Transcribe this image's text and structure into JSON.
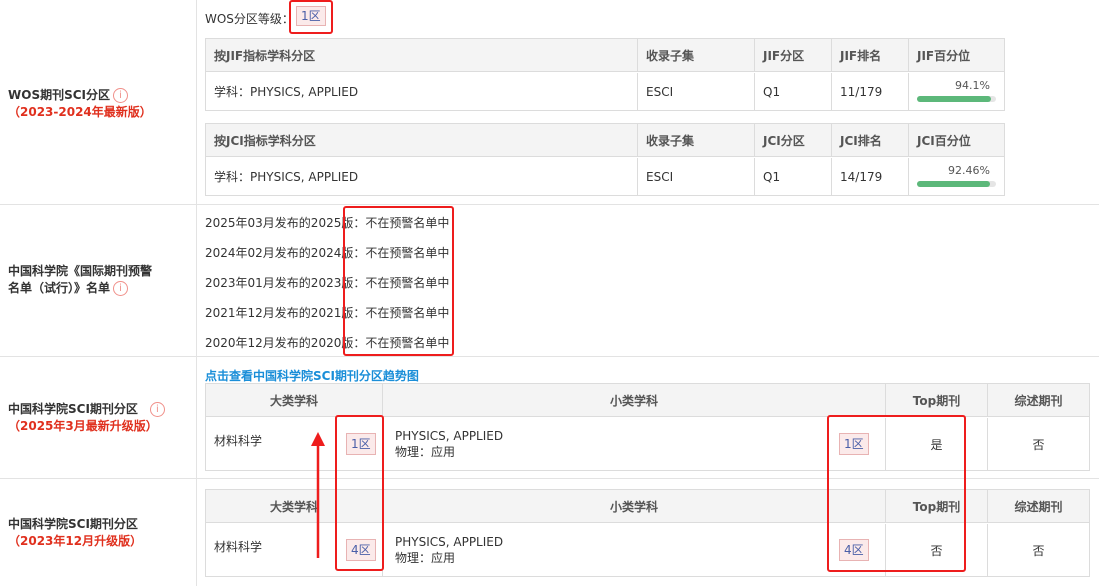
{
  "wos": {
    "level_label": "WOS分区等级：",
    "level_value": "1区",
    "title": "WOS期刊SCI分区",
    "subtitle": "（2023-2024年最新版）",
    "jif_table": {
      "headers": [
        "按JIF指标学科分区",
        "收录子集",
        "JIF分区",
        "JIF排名",
        "JIF百分位"
      ],
      "row": {
        "subject": "学科：PHYSICS, APPLIED",
        "collection": "ESCI",
        "quartile": "Q1",
        "rank": "11/179",
        "percentile_text": "94.1%",
        "percentile": 0.941
      }
    },
    "jci_table": {
      "headers": [
        "按JCI指标学科分区",
        "收录子集",
        "JCI分区",
        "JCI排名",
        "JCI百分位"
      ],
      "row": {
        "subject": "学科：PHYSICS, APPLIED",
        "collection": "ESCI",
        "quartile": "Q1",
        "rank": "14/179",
        "percentile_text": "92.46%",
        "percentile": 0.9246
      }
    }
  },
  "warning": {
    "title_line1": "中国科学院《国际期刊预警",
    "title_line2": "名单（试行）》名单",
    "items": [
      {
        "label": "2025年03月发布的2025版：",
        "status": "不在预警名单中"
      },
      {
        "label": "2024年02月发布的2024版：",
        "status": "不在预警名单中"
      },
      {
        "label": "2023年01月发布的2023版：",
        "status": "不在预警名单中"
      },
      {
        "label": "2021年12月发布的2021版：",
        "status": "不在预警名单中"
      },
      {
        "label": "2020年12月发布的2020版：",
        "status": "不在预警名单中"
      }
    ]
  },
  "cas2025": {
    "link": "点击查看中国科学院SCI期刊分区趋势图",
    "title": "中国科学院SCI期刊分区",
    "subtitle": "（2025年3月最新升级版）",
    "headers": [
      "大类学科",
      "小类学科",
      "Top期刊",
      "综述期刊"
    ],
    "row": {
      "major": "材料科学",
      "major_zone": "1区",
      "minor_en": "PHYSICS, APPLIED",
      "minor_cn": "物理：应用",
      "minor_zone": "1区",
      "top": "是",
      "review": "否"
    }
  },
  "cas2023": {
    "title": "中国科学院SCI期刊分区",
    "subtitle": "（2023年12月升级版）",
    "headers": [
      "大类学科",
      "小类学科",
      "Top期刊",
      "综述期刊"
    ],
    "row": {
      "major": "材料科学",
      "major_zone": "4区",
      "minor_en": "PHYSICS, APPLIED",
      "minor_cn": "物理：应用",
      "minor_zone": "4区",
      "top": "否",
      "review": "否"
    }
  },
  "colors": {
    "accent_red": "#e0301e",
    "link_blue": "#1a8ed8",
    "bar_green": "#5cb87a",
    "annotation_red": "#ee1d1d"
  },
  "icons": [
    "info-icon",
    "arrow-up-annotation"
  ]
}
